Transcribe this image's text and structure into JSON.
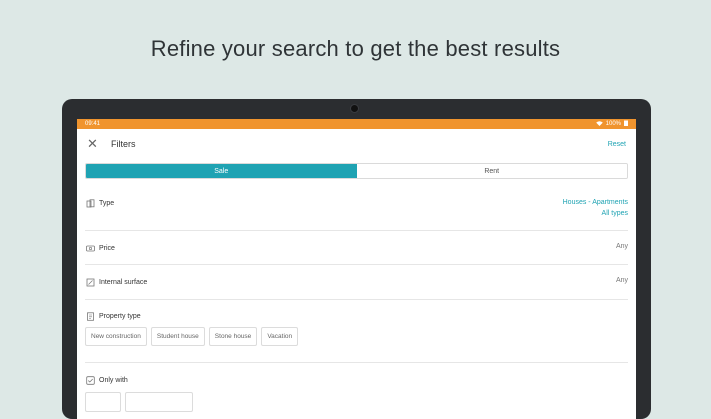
{
  "headline": "Refine your search to get the best results",
  "status_bar": {
    "time": "09:41",
    "battery": "100%"
  },
  "app_bar": {
    "title": "Filters",
    "reset_label": "Reset"
  },
  "contract_toggle": {
    "options": [
      "Sale",
      "Rent"
    ],
    "selected": "Sale"
  },
  "filters": {
    "type": {
      "label": "Type",
      "value_line1": "Houses - Apartments",
      "value_line2": "All types"
    },
    "price": {
      "label": "Price",
      "value": "Any"
    },
    "internal_surface": {
      "label": "Internal surface",
      "value": "Any"
    },
    "property_type": {
      "label": "Property type",
      "chips": [
        "New construction",
        "Student house",
        "Stone house",
        "Vacation"
      ]
    },
    "only_with": {
      "label": "Only with"
    }
  },
  "colors": {
    "accent": "#1fa3b3",
    "status_bar": "#f0942e",
    "background": "#dde8e6"
  },
  "icons": [
    "close-icon",
    "type-icon",
    "price-icon",
    "surface-icon",
    "property-type-icon",
    "checkbox-icon",
    "wifi-icon",
    "battery-icon"
  ]
}
